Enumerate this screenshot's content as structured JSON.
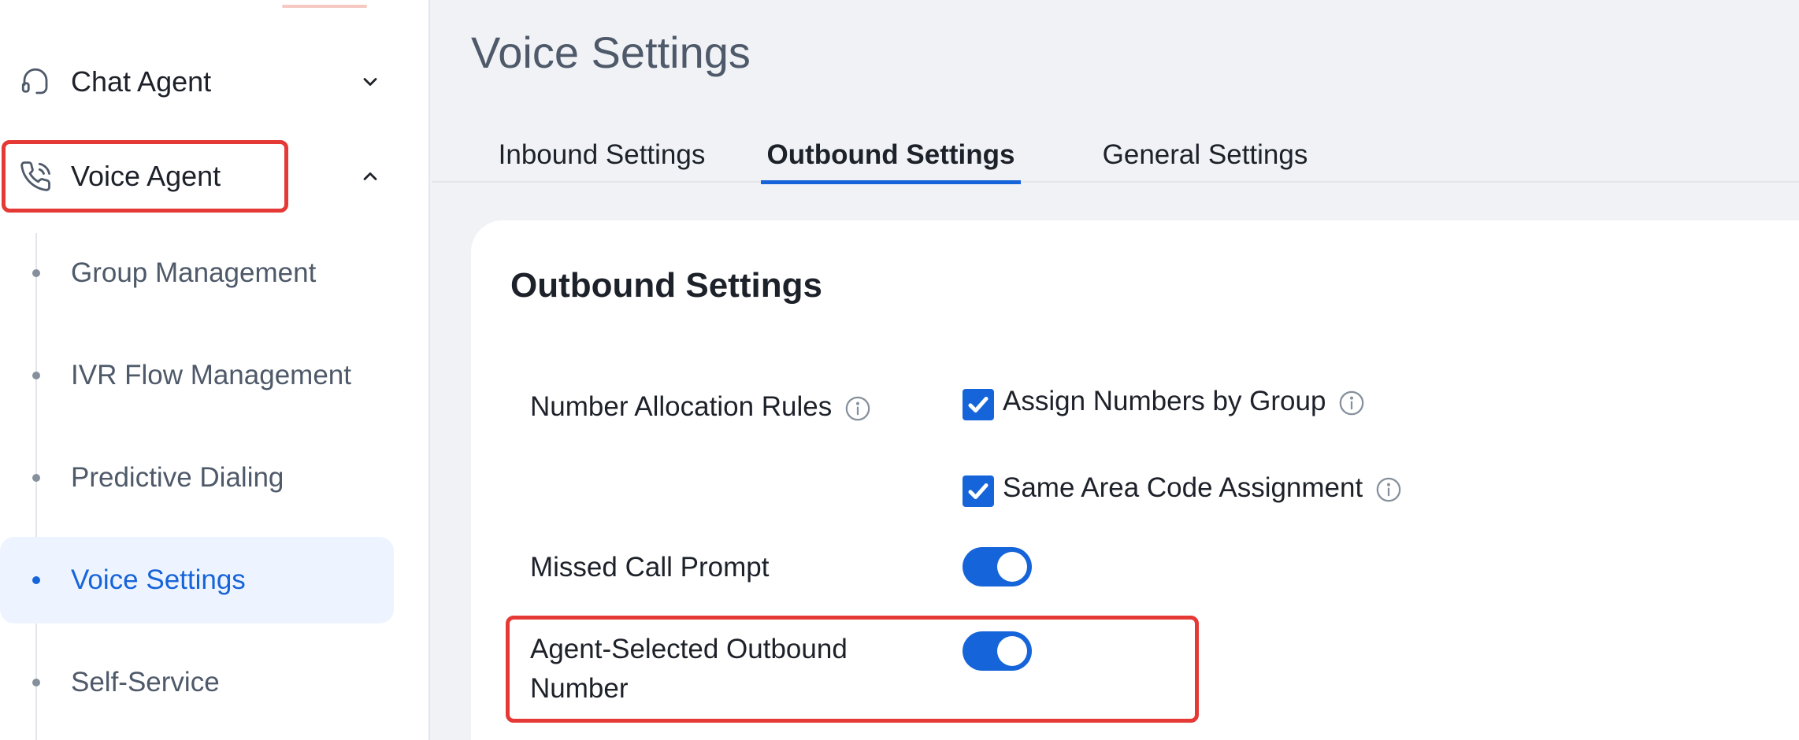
{
  "sidebar": {
    "items": [
      {
        "label": "Chat Agent",
        "icon": "headset-icon",
        "expanded": false
      },
      {
        "label": "Voice Agent",
        "icon": "phone-call-icon",
        "expanded": true
      }
    ],
    "sub_items": [
      {
        "label": "Group Management"
      },
      {
        "label": "IVR Flow Management"
      },
      {
        "label": "Predictive Dialing"
      },
      {
        "label": "Voice Settings",
        "active": true
      },
      {
        "label": "Self-Service"
      }
    ]
  },
  "main": {
    "title": "Voice Settings",
    "tabs": [
      {
        "label": "Inbound Settings"
      },
      {
        "label": "Outbound Settings",
        "active": true
      },
      {
        "label": "General Settings"
      }
    ],
    "card": {
      "title": "Outbound Settings",
      "number_allocation": {
        "label": "Number Allocation Rules",
        "options": [
          {
            "label": "Assign Numbers by Group",
            "checked": true
          },
          {
            "label": "Same Area Code Assignment",
            "checked": true
          }
        ]
      },
      "missed_call": {
        "label": "Missed Call Prompt",
        "enabled": true
      },
      "agent_selected": {
        "label_line1": "Agent-Selected Outbound",
        "label_line2": "Number",
        "enabled": true
      }
    }
  },
  "colors": {
    "accent": "#1664d9",
    "highlight": "#e53935",
    "active_bg": "#eef4ff"
  }
}
